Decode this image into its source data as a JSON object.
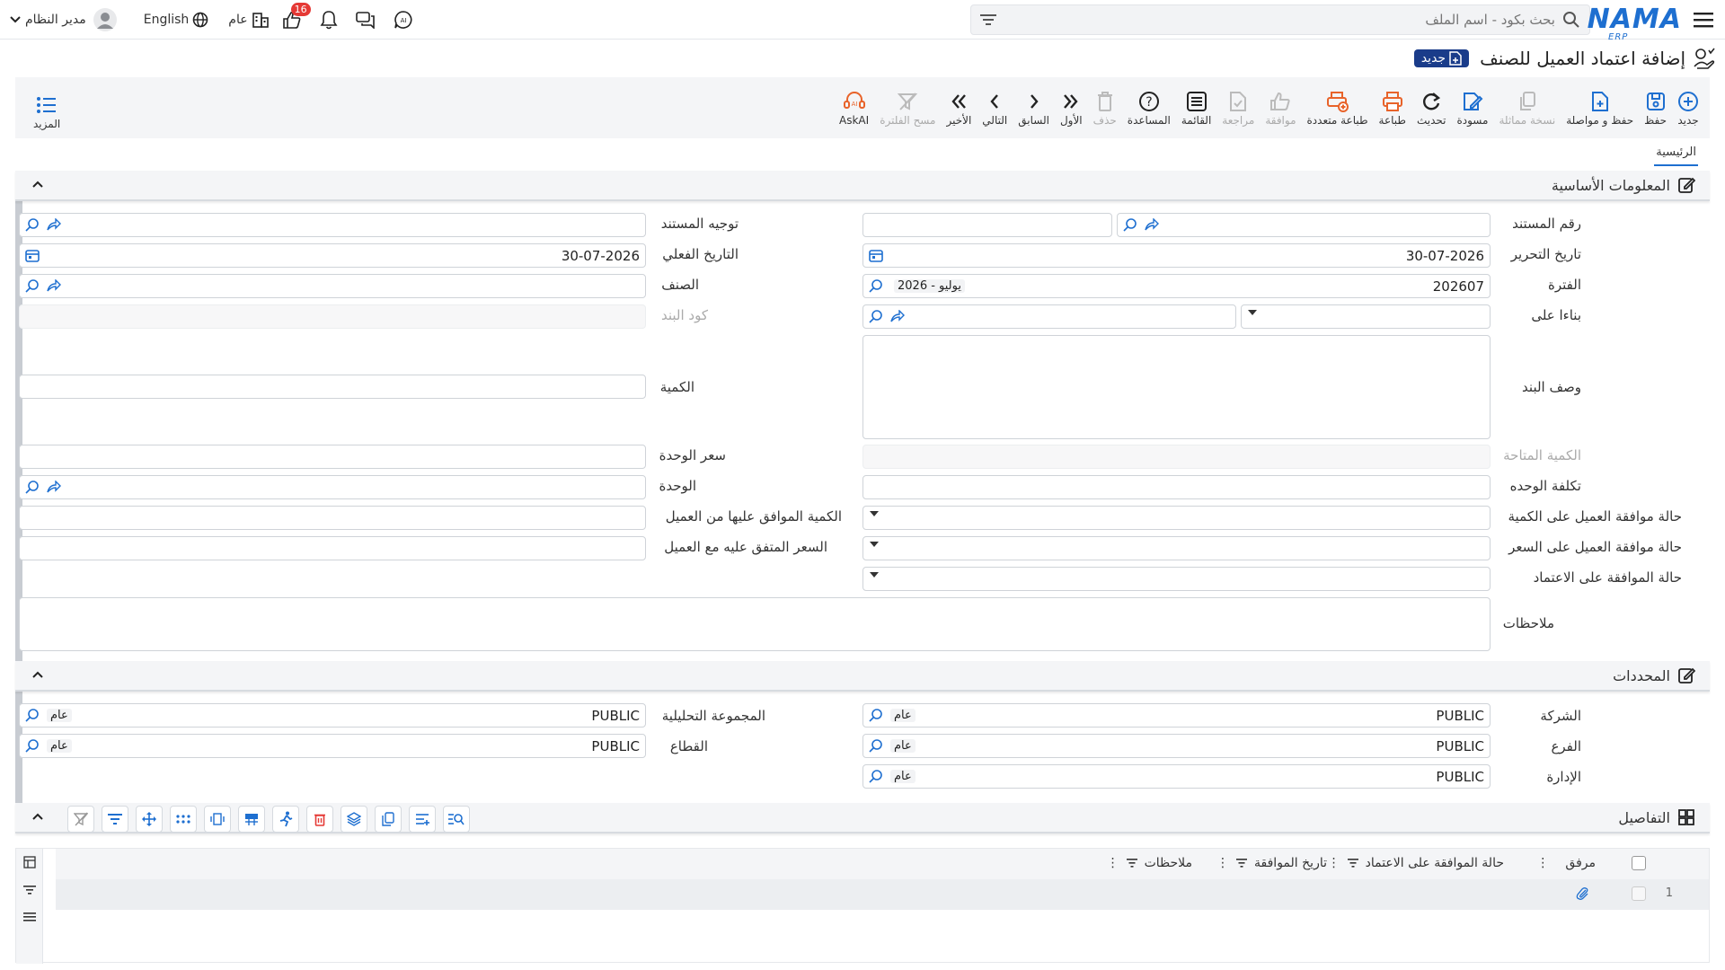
{
  "topbar": {
    "search_placeholder": "بحث بكود - اسم الملف",
    "logo": "NAMA",
    "logo_sub": "ERP",
    "user_name": "مدير النظام",
    "language": "English",
    "scope": "عام",
    "notifications_count": "16"
  },
  "page": {
    "title": "إضافة اعتماد العميل للصنف",
    "status_badge": "جديد"
  },
  "toolbar": {
    "buttons": [
      "جديد",
      "حفظ",
      "حفظ و مواصلة",
      "نسخة مماثلة",
      "مسودة",
      "تحديث",
      "طباعة",
      "طباعة متعددة",
      "موافقة",
      "مراجعة",
      "القائمة",
      "المساعدة",
      "حذف",
      "الأول",
      "السابق",
      "التالي",
      "الأخير",
      "مسح الفلترة",
      "AskAI"
    ],
    "more": "المزيد"
  },
  "tabs": {
    "main": "الرئيسية"
  },
  "sections": {
    "basic": "المعلومات الأساسية",
    "determinants": "المحددات",
    "details": "التفاصيل"
  },
  "form": {
    "doc_number_label": "رقم المستند",
    "doc_direction_label": "توجيه المستند",
    "edit_date_label": "تاريخ التحرير",
    "edit_date": "30-07-2026",
    "actual_date_label": "التاريخ الفعلي",
    "actual_date": "30-07-2026",
    "period_label": "الفترة",
    "period_code": "202607",
    "period_name": "2026 - يوليو",
    "item_label": "الصنف",
    "based_on_label": "بناءا على",
    "item_code_label": "كود البند",
    "item_desc_label": "وصف البند",
    "quantity_label": "الكمية",
    "available_qty_label": "الكمية المتاحة",
    "unit_price_label": "سعر الوحدة",
    "unit_cost_label": "تكلفة الوحده",
    "unit_label": "الوحدة",
    "qty_approval_status_label": "حالة موافقة العميل على الكمية",
    "customer_agreed_qty_label": "الكمية الموافق عليها من العميل",
    "price_approval_status_label": "حالة موافقة العميل على السعر",
    "customer_agreed_price_label": "السعر المتفق عليه مع العميل",
    "approval_status_label": "حالة الموافقة على الاعتماد",
    "notes_label": "ملاحظات"
  },
  "determinants": {
    "company_label": "الشركة",
    "company_code": "PUBLIC",
    "company_name": "عام",
    "analytic_group_label": "المجموعة التحليلية",
    "analytic_group_code": "PUBLIC",
    "analytic_group_name": "عام",
    "branch_label": "الفرع",
    "branch_code": "PUBLIC",
    "branch_name": "عام",
    "sector_label": "القطاع",
    "sector_code": "PUBLIC",
    "sector_name": "عام",
    "department_label": "الإدارة",
    "department_code": "PUBLIC",
    "department_name": "عام"
  },
  "grid": {
    "columns": [
      "مرفق",
      "حالة الموافقة على الاعتماد",
      "تاريخ الموافقة",
      "ملاحظات"
    ],
    "row_number": "1"
  },
  "colors": {
    "accent": "#1e6fd0",
    "toolbar_bg": "#f4f5f7",
    "badge": "#1a3c8a",
    "print_orange": "#e8632a",
    "notify_red": "#e53935"
  }
}
